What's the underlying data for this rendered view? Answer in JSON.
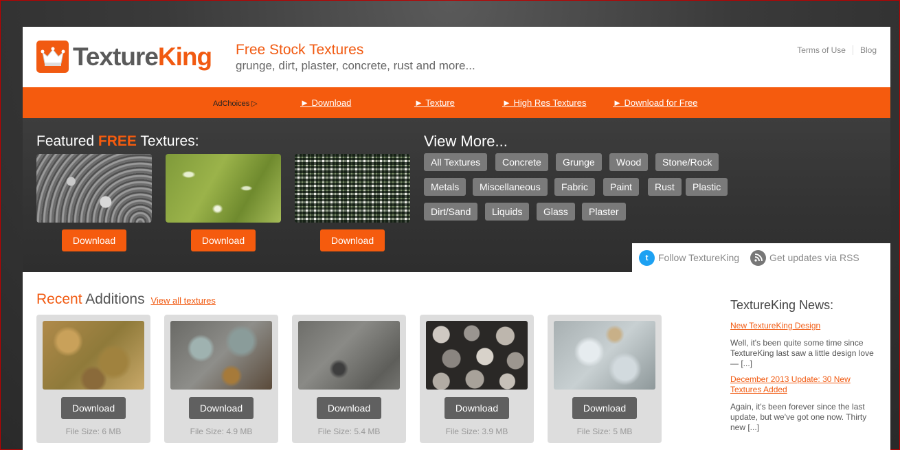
{
  "header": {
    "logo_part1": "Texture",
    "logo_part2": "King",
    "tagline_title": "Free Stock Textures",
    "tagline_sub": "grunge, dirt, plaster, concrete, rust and more...",
    "links": [
      "Terms of Use",
      "Blog"
    ]
  },
  "nav": {
    "adchoices": "AdChoices ▷",
    "items": [
      "► Download",
      "► Texture",
      "► High Res Textures",
      "► Download for Free"
    ]
  },
  "featured": {
    "title_prefix": "Featured ",
    "title_highlight": "FREE",
    "title_suffix": " Textures:",
    "button_label": "Download"
  },
  "view_more": {
    "title": "View More...",
    "tags": [
      "All Textures",
      "Concrete",
      "Grunge",
      "Wood",
      "Stone/Rock",
      "Metals",
      "Miscellaneous",
      "Fabric",
      "Paint",
      "Rust",
      "Plastic",
      "Dirt/Sand",
      "Liquids",
      "Glass",
      "Plaster"
    ]
  },
  "social": {
    "follow": "Follow TextureKing",
    "rss": "Get updates via RSS"
  },
  "recent": {
    "title_highlight": "Recent",
    "title_rest": " Additions",
    "view_all": "View all textures",
    "button_label": "Download",
    "sizes": [
      "File Size: 6 MB",
      "File Size: 4.9 MB",
      "File Size: 5.4 MB",
      "File Size: 3.9 MB",
      "File Size: 5 MB"
    ]
  },
  "news": {
    "title": "TextureKing News:",
    "items": [
      {
        "link": "New TextureKing Design",
        "text": "Well, it's been quite some time since TextureKing last saw a little design love — [...]"
      },
      {
        "link": "December 2013 Update: 30 New Textures Added",
        "text": "Again, it's been forever since the last update, but we've got one now. Thirty new [...]"
      }
    ]
  }
}
